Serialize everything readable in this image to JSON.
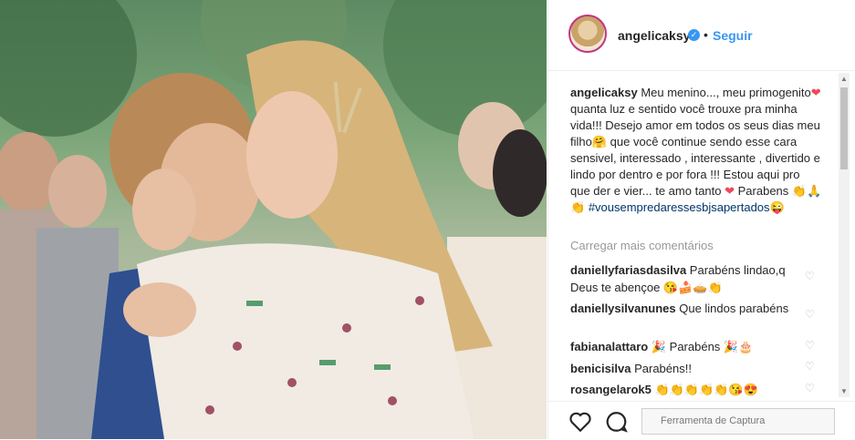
{
  "post": {
    "username": "angelicaksy",
    "separator": "•",
    "follow_label": "Seguir"
  },
  "caption": {
    "user": "angelicaksy",
    "text1": " Meu menino..., meu primogenito",
    "text2": " quanta luz e sentido você trouxe pra minha vida!!! Desejo amor em todos os seus dias meu filho",
    "text3": " que você continue sendo esse cara sensivel, interessado , interessante , divertido e lindo por dentro e por fora !!! Estou aqui pro que der e vier... te amo tanto ",
    "text4": " Parabens 👏🙏👏 ",
    "hashtag": "#vousempredaressesbjsapertados",
    "emoji_end": "😜"
  },
  "load_more_label": "Carregar mais comentários",
  "comments": [
    {
      "user": "daniellyfariasdasilva",
      "text": " Parabéns lindao,q Deus te abençoe 😘🍰🥧👏"
    },
    {
      "user": "daniellysilvanunes",
      "text": " Que lindos parabéns"
    },
    {
      "user": "fabianalattaro",
      "text": " 🎉 Parabéns 🎉🎂"
    },
    {
      "user": "benicisilva",
      "text": " Parabéns!!"
    },
    {
      "user": "rosangelarok5",
      "text": " 👏👏👏👏👏😘😍"
    }
  ],
  "tooltip_text": "Ferramenta de Captura",
  "colors": {
    "link": "#3897f0",
    "verified": "#3897f0",
    "heart": "#ed4956"
  },
  "icons": [
    "heart-icon",
    "comment-icon",
    "share-icon",
    "bookmark-icon",
    "verified-icon"
  ]
}
